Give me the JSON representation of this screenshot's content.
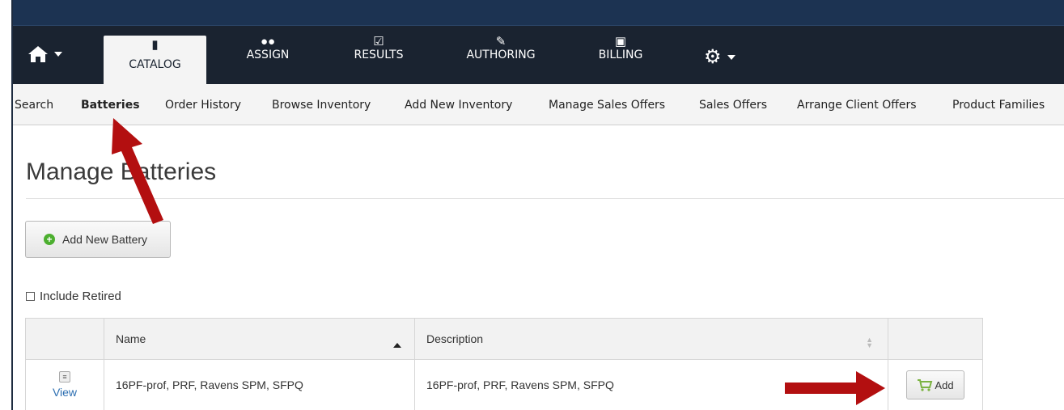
{
  "top_nav": {
    "items": [
      {
        "label": "CATALOG",
        "icon": "book-icon",
        "active": true
      },
      {
        "label": "ASSIGN",
        "icon": "users-icon",
        "active": false
      },
      {
        "label": "RESULTS",
        "icon": "checkbox-icon",
        "active": false
      },
      {
        "label": "AUTHORING",
        "icon": "pencil-icon",
        "active": false
      },
      {
        "label": "BILLING",
        "icon": "money-icon",
        "active": false
      }
    ]
  },
  "sub_nav": {
    "items": [
      {
        "label": "Search"
      },
      {
        "label": "Batteries",
        "active": true
      },
      {
        "label": "Order History"
      },
      {
        "label": "Browse Inventory"
      },
      {
        "label": "Add New Inventory"
      },
      {
        "label": "Manage Sales Offers"
      },
      {
        "label": "Sales Offers"
      },
      {
        "label": "Arrange Client Offers"
      },
      {
        "label": "Product Families"
      }
    ]
  },
  "page": {
    "title": "Manage Batteries",
    "add_button": "Add New Battery",
    "include_retired": "Include Retired"
  },
  "table": {
    "headers": [
      "Name",
      "Description"
    ],
    "rows": [
      {
        "view_label": "View",
        "name": "16PF-prof, PRF, Ravens SPM, SFPQ",
        "description": "16PF-prof, PRF, Ravens SPM, SFPQ",
        "add_label": "Add"
      }
    ]
  },
  "colors": {
    "navbar": "#1a2330",
    "topbar": "#1c3352",
    "arrow": "#b30f10",
    "add_green": "#4caf2f"
  }
}
